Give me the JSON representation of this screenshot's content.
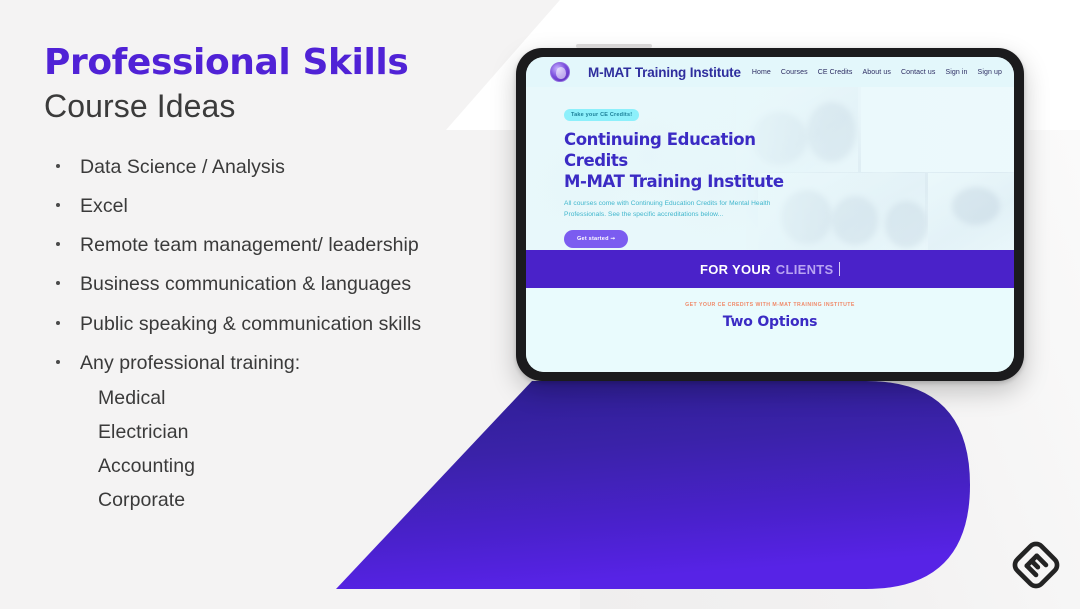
{
  "slide": {
    "title_highlight": "Professional Skills",
    "title_sub": "Course Ideas",
    "bullets": [
      {
        "text": "Data Science / Analysis",
        "sub": []
      },
      {
        "text": "Excel",
        "sub": []
      },
      {
        "text": "Remote team management/ leadership",
        "sub": []
      },
      {
        "text": "Business communication & languages",
        "sub": []
      },
      {
        "text": "Public speaking & communication skills",
        "sub": []
      },
      {
        "text": "Any professional training:",
        "sub": [
          "Medical",
          "Electrician",
          "Accounting",
          "Corporate"
        ]
      }
    ],
    "accent_color": "#5022d6",
    "text_color": "#3a3a3a",
    "background_color": "#f4f3f3"
  },
  "bullet_items": {
    "b0": "Data Science / Analysis",
    "b1": "Excel",
    "b2": "Remote team management/ leadership",
    "b3": "Business communication & languages",
    "b4": "Public speaking & communication skills",
    "b5": "Any professional training:",
    "s0": "Medical",
    "s1": "Electrician",
    "s2": "Accounting",
    "s3": "Corporate"
  },
  "tablet": {
    "device": "tablet-mockup",
    "site": {
      "brand_name": "M-MAT Training Institute",
      "logo_icon": "circular-brand-logo-icon",
      "nav": [
        "Home",
        "Courses",
        "CE Credits",
        "About us",
        "Contact us",
        "Sign in",
        "Sign up"
      ],
      "hero": {
        "badge": "Take your CE Credits!",
        "heading_line1": "Continuing Education Credits",
        "heading_line2": "M-MAT Training Institute",
        "subtext": "All courses come with Continuing Education Credits for Mental Health Professionals. See the specific accreditations below...",
        "cta_label": "Get started",
        "cta_icon": "arrow-right-icon",
        "heading_color": "#3b2bc4",
        "subtext_color": "#3fb6cc",
        "badge_bg": "#8df0fb",
        "cta_bg": "#7b5cf0"
      },
      "band": {
        "text_primary": "FOR YOUR",
        "text_secondary": "CLIENTS",
        "caret": "|",
        "bg": "#4a22c9"
      },
      "bottom": {
        "kicker": "GET YOUR CE CREDITS WITH M-MAT TRAINING INSTITUTE",
        "kicker_color": "#f08a6a",
        "heading": "Two Options",
        "heading_color": "#3b2bc4",
        "bg": "#e9fbfd"
      }
    }
  },
  "decor": {
    "purple_shape_gradient_from": "#2e1f95",
    "purple_shape_gradient_to": "#5523e3",
    "corner_logo_icon": "diamond-brand-logo-icon"
  }
}
